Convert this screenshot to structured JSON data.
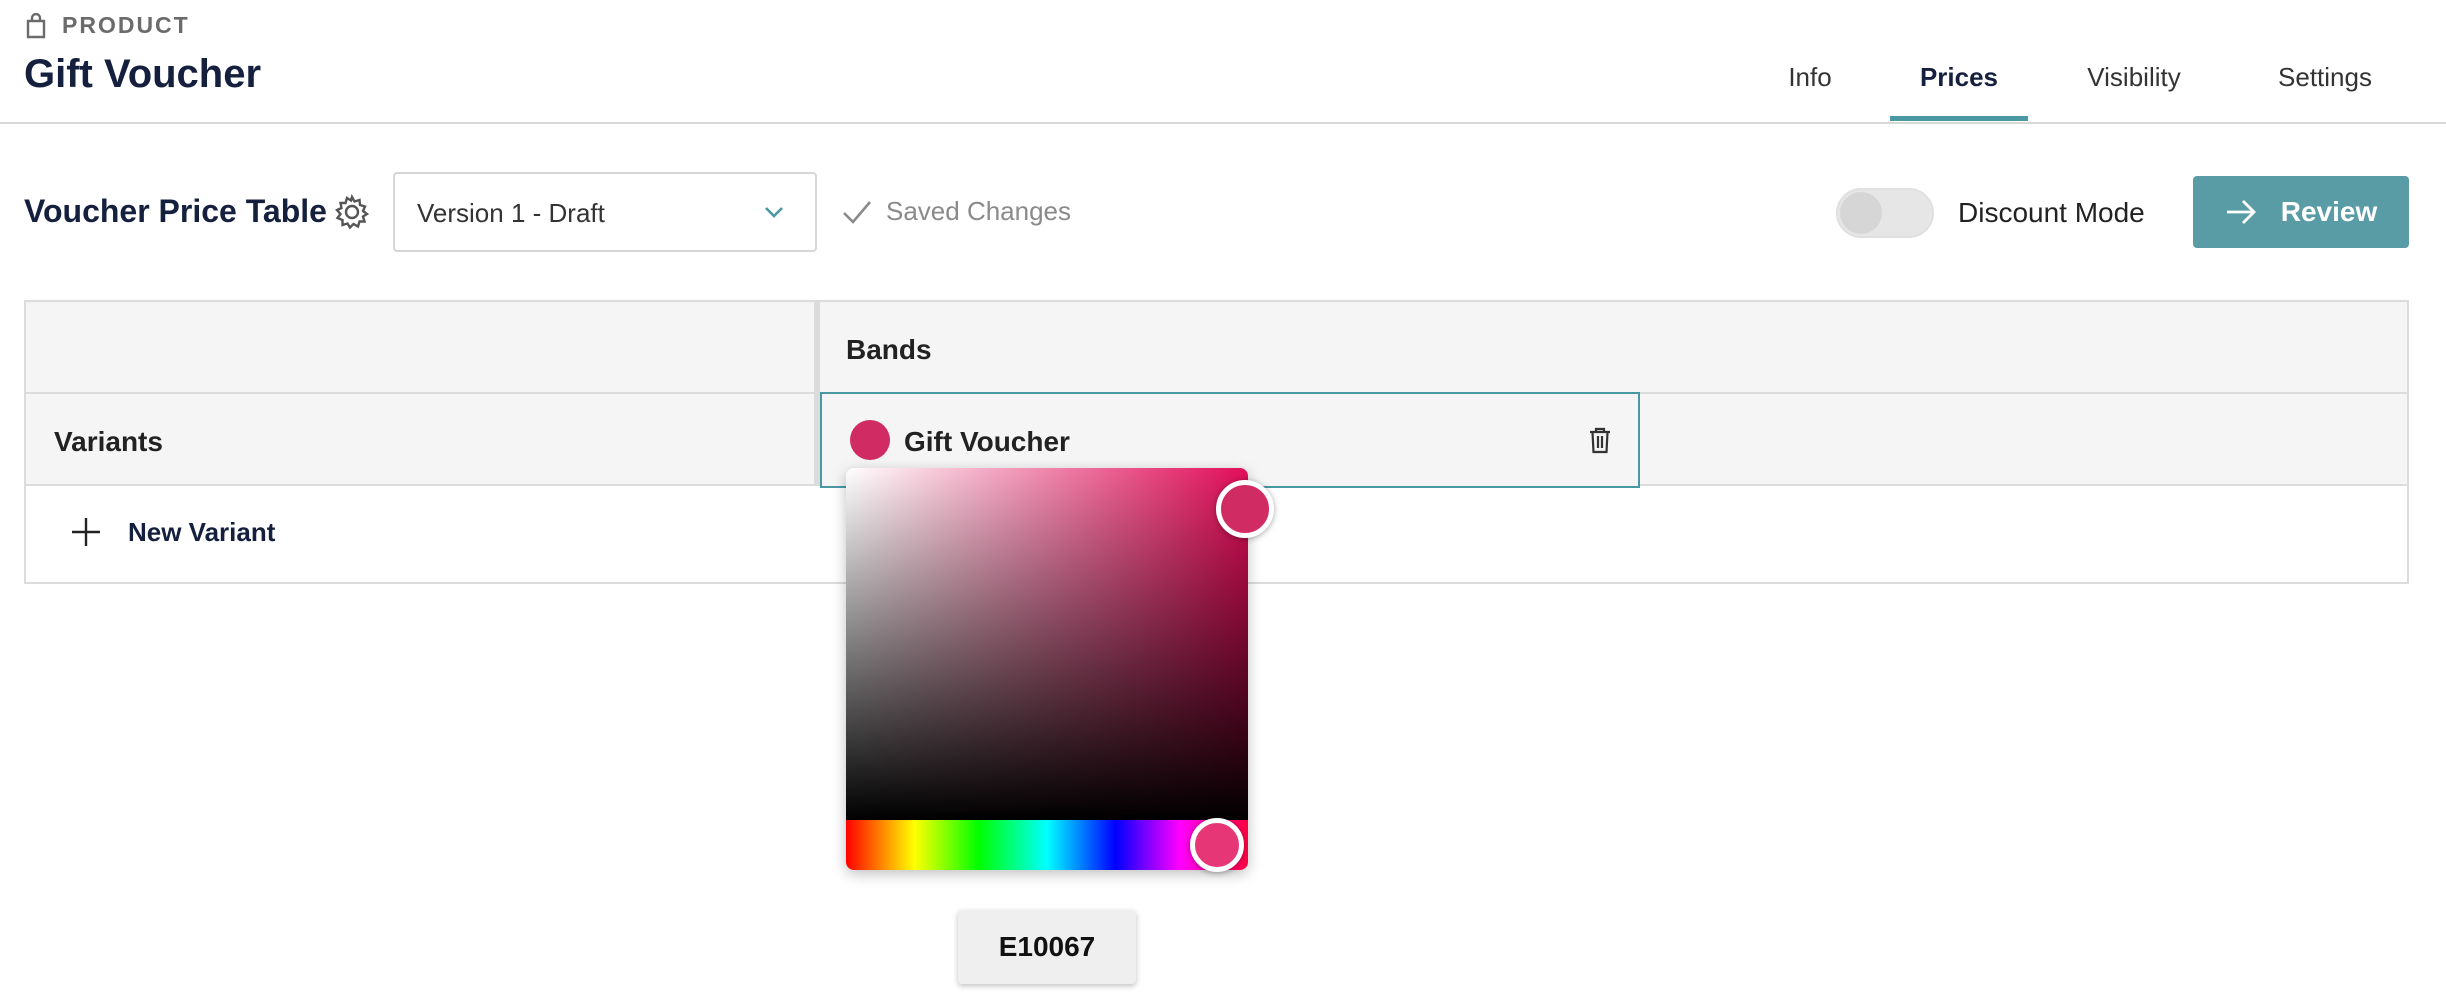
{
  "header": {
    "eyebrow": "PRODUCT",
    "title": "Gift Voucher",
    "eyebrow_icon": "shopping-bag-icon"
  },
  "tabs": [
    {
      "label": "Info",
      "active": false
    },
    {
      "label": "Prices",
      "active": true
    },
    {
      "label": "Visibility",
      "active": false
    },
    {
      "label": "Settings",
      "active": false
    }
  ],
  "toolbar": {
    "section_title": "Voucher Price Table",
    "settings_icon": "gear-icon",
    "version_select": {
      "value": "Version 1 - Draft",
      "icon": "chevron-down-icon"
    },
    "saved_status": "Saved Changes",
    "saved_icon": "check-icon",
    "discount_mode": {
      "label": "Discount Mode",
      "enabled": false
    },
    "review_button": {
      "label": "Review",
      "icon": "arrow-right-icon"
    }
  },
  "table": {
    "bands_header": "Bands",
    "variants_header": "Variants",
    "band": {
      "name": "Gift Voucher",
      "color": "#d12b64",
      "delete_icon": "trash-icon"
    },
    "new_variant_label": "New Variant",
    "new_variant_icon": "plus-icon"
  },
  "color_picker": {
    "hex_value": "E10067",
    "hue_color": "#e10d58"
  },
  "colors": {
    "accent": "#4a98a4",
    "primary_button": "#5a9ca5",
    "title": "#14203d"
  }
}
